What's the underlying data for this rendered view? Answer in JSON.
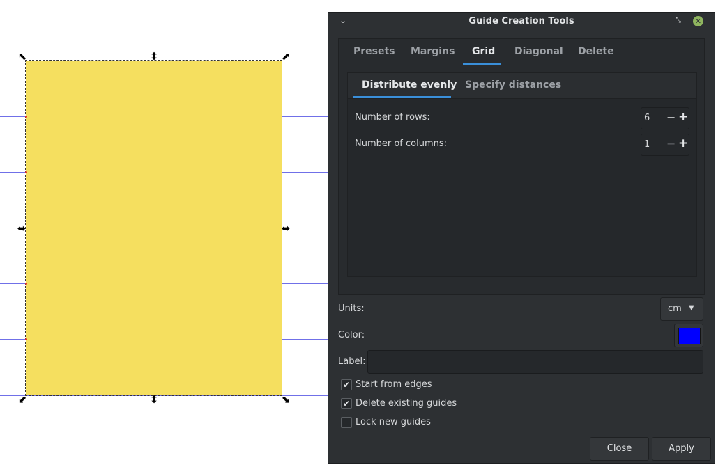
{
  "dialog": {
    "title": "Guide Creation Tools",
    "tabs": [
      "Presets",
      "Margins",
      "Grid",
      "Diagonal",
      "Delete"
    ],
    "active_tab": "Grid",
    "subtabs": [
      "Distribute evenly",
      "Specify distances"
    ],
    "active_subtab": "Distribute evenly",
    "rows_label": "Number of rows:",
    "rows_value": "6",
    "columns_label": "Number of columns:",
    "columns_value": "1",
    "units_label": "Units:",
    "units_value": "cm",
    "color_label": "Color:",
    "color_value": "#0000ff",
    "label_label": "Label:",
    "label_value": "",
    "checkboxes": [
      {
        "label": "Start from edges",
        "checked": true
      },
      {
        "label": "Delete existing guides",
        "checked": true
      },
      {
        "label": "Lock new guides",
        "checked": false
      }
    ],
    "close_label": "Close",
    "apply_label": "Apply"
  },
  "canvas": {
    "rectangle_fill": "#f5df5f",
    "guide_color": "#7070e8"
  },
  "icons": {
    "menu": "chevron-down-icon",
    "restore": "restore-icon",
    "close": "close-icon"
  }
}
